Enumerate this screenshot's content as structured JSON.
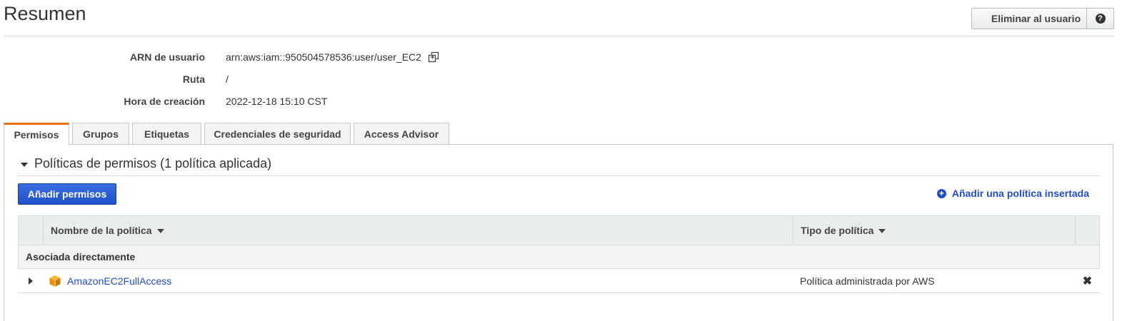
{
  "header": {
    "title": "Resumen",
    "delete_button": "Eliminar al usuario",
    "help_symbol": "?"
  },
  "summary": {
    "arn": {
      "label": "ARN de usuario",
      "value": "arn:aws:iam::950504578536:user/user_EC2"
    },
    "path": {
      "label": "Ruta",
      "value": "/"
    },
    "created": {
      "label": "Hora de creación",
      "value": "2022-12-18 15:10 CST"
    }
  },
  "tabs": [
    {
      "label": "Permisos",
      "active": true
    },
    {
      "label": "Grupos",
      "active": false
    },
    {
      "label": "Etiquetas",
      "active": false
    },
    {
      "label": "Credenciales de seguridad",
      "active": false
    },
    {
      "label": "Access Advisor",
      "active": false
    }
  ],
  "permissions": {
    "section_title": "Políticas de permisos (1 política aplicada)",
    "add_button": "Añadir permisos",
    "inline_policy_link": "Añadir una política insertada",
    "plus_symbol": "+",
    "table": {
      "columns": {
        "name": "Nombre de la política",
        "type": "Tipo de política"
      },
      "group_label": "Asociada directamente",
      "rows": [
        {
          "name": "AmazonEC2FullAccess",
          "type": "Política administrada por AWS",
          "remove_symbol": "✖"
        }
      ]
    }
  },
  "colors": {
    "accent_tab": "#ec7211",
    "primary_button": "#1e4fc9",
    "link": "#1e4fc9",
    "policy_icon": "#f0a30a"
  },
  "icons": {
    "copy": "copy-icon",
    "help": "help-icon",
    "plus_circle": "plus-circle-icon",
    "policy": "cube-icon",
    "remove": "close-icon"
  }
}
